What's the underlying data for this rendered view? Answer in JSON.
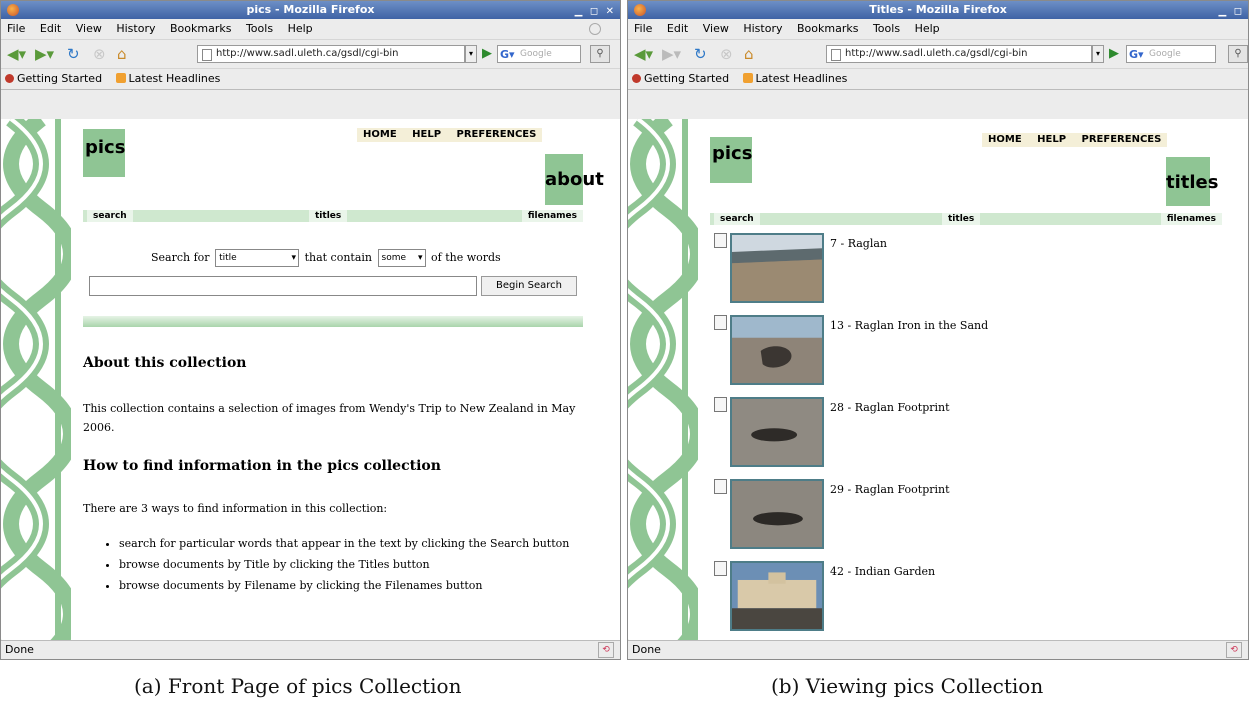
{
  "left": {
    "window_title": "pics - Mozilla Firefox",
    "menu": [
      "File",
      "Edit",
      "View",
      "History",
      "Bookmarks",
      "Tools",
      "Help"
    ],
    "url": "http://www.sadl.uleth.ca/gsdl/cgi-bin",
    "search_placeholder": "Google",
    "bookmarks": [
      "Getting Started",
      "Latest Headlines"
    ],
    "status": "Done",
    "collection_title": "pics",
    "top_nav": [
      "HOME",
      "HELP",
      "PREFERENCES"
    ],
    "page_label": "about",
    "nav_buttons": [
      "search",
      "titles",
      "filenames"
    ],
    "search_for_label": "Search for",
    "search_field_value": "title",
    "that_contain_label": "that contain",
    "match_value": "some",
    "of_words_label": "of the words",
    "begin_search": "Begin Search",
    "about_heading": "About this collection",
    "about_text": "This collection contains a selection of images from Wendy's Trip to New Zealand in May 2006.",
    "howto_heading": "How to find information in the pics collection",
    "howto_intro": "There are 3 ways to find information in this collection:",
    "howto_items": [
      "search for particular words that appear in the text by clicking the Search button",
      "browse documents by Title by clicking the Titles button",
      "browse documents by Filename by clicking the Filenames button"
    ]
  },
  "right": {
    "window_title": "Titles - Mozilla Firefox",
    "menu": [
      "File",
      "Edit",
      "View",
      "History",
      "Bookmarks",
      "Tools",
      "Help"
    ],
    "url": "http://www.sadl.uleth.ca/gsdl/cgi-bin",
    "search_placeholder": "Google",
    "bookmarks": [
      "Getting Started",
      "Latest Headlines"
    ],
    "status": "Done",
    "collection_title": "pics",
    "top_nav": [
      "HOME",
      "HELP",
      "PREFERENCES"
    ],
    "page_label": "titles",
    "nav_buttons": [
      "search",
      "titles",
      "filenames"
    ],
    "documents": [
      {
        "label": "7 - Raglan"
      },
      {
        "label": "13 - Raglan Iron in the Sand"
      },
      {
        "label": "28 - Raglan Footprint"
      },
      {
        "label": "29 - Raglan Footprint"
      },
      {
        "label": "42 - Indian Garden"
      }
    ]
  },
  "captions": {
    "left": "(a) Front Page of pics Collection",
    "right": "(b) Viewing pics Collection"
  },
  "colors": {
    "accent_green": "#8fc594",
    "titlebar_blue": "#3f63a5"
  }
}
